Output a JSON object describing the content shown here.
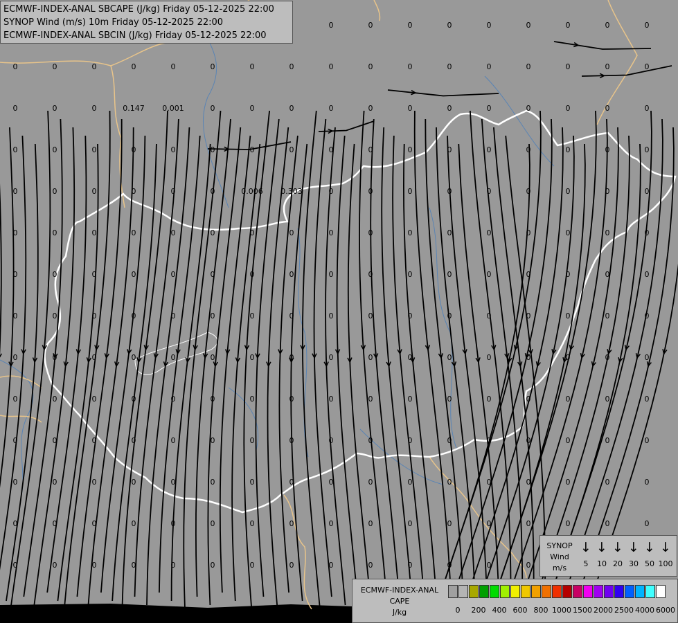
{
  "title": {
    "line1": "ECMWF-INDEX-ANAL SBCAPE (J/kg) Friday 05-12-2025 22:00",
    "line2": "SYNOP Wind (m/s) 10m Friday 05-12-2025 22:00",
    "line3": "ECMWF-INDEX-ANAL SBCIN (J/kg) Friday 05-12-2025 22:00"
  },
  "colors": {
    "background": "#999999",
    "border": "#ffffff",
    "neighbour_border": "#e8c48a",
    "river": "#5a84b4",
    "streamline": "#000000"
  },
  "value_labels": [
    "0",
    "0.147",
    "0.001",
    "0.006",
    "0.303"
  ],
  "wind_legend": {
    "header": [
      "SYNOP",
      "Wind",
      "m/s"
    ],
    "arrow": "↓",
    "values": [
      "5",
      "10",
      "20",
      "30",
      "50",
      "100"
    ]
  },
  "cape_legend": {
    "header": [
      "ECMWF-INDEX-ANAL",
      "CAPE",
      "J/kg"
    ],
    "colors": [
      "#a0a0a0",
      "#b4b4b4",
      "#a8a800",
      "#00a000",
      "#00dc00",
      "#a0f000",
      "#f0f000",
      "#f0c800",
      "#f0a000",
      "#f07000",
      "#f03000",
      "#b40000",
      "#c80064",
      "#f000f0",
      "#a000f0",
      "#7000f0",
      "#3000f0",
      "#0060ff",
      "#00b4ff",
      "#40ffff",
      "#ffffff"
    ],
    "ticks": [
      "0",
      "200",
      "400",
      "600",
      "800",
      "1000",
      "1500",
      "2000",
      "2500",
      "4000",
      "6000"
    ]
  }
}
